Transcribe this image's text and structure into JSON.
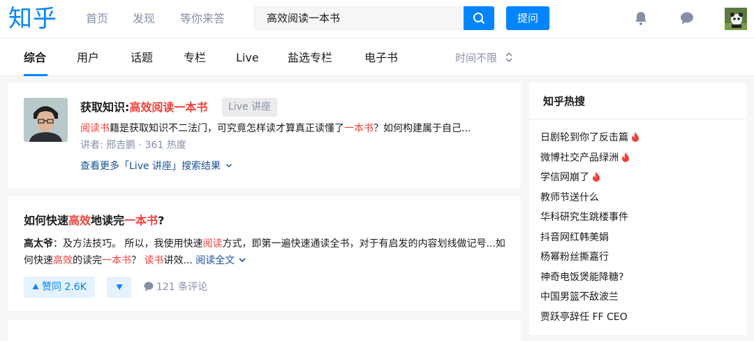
{
  "header": {
    "logo": "知乎",
    "nav": [
      "首页",
      "发现",
      "等你来答"
    ],
    "search_value": "高效阅读一本书",
    "ask_label": "提问",
    "accent": "#0084ff"
  },
  "tabs": {
    "items": [
      "综合",
      "用户",
      "话题",
      "专栏",
      "Live",
      "盐选专栏",
      "电子书"
    ],
    "active": "综合",
    "time_filter": "时间不限"
  },
  "live_card": {
    "title_prefix": "获取知识:",
    "title_highlight": "高效阅读一本书",
    "tag": "Live 讲座",
    "desc_hl1": "阅读书",
    "desc_text1": "籍是获取知识不二法门，可究竟怎样读才算真正读懂了",
    "desc_hl2": "一本书",
    "desc_text2": "？如何构建属于自己...",
    "meta": "讲者: 邢吉鹏 · 361 热度",
    "more_link": "查看更多「Live 讲座」搜索结果"
  },
  "question_card": {
    "title_1": "如何快速",
    "title_hl1": "高效",
    "title_2": "地读完",
    "title_hl2": "一本书",
    "title_3": "?",
    "author": "高太爷",
    "body_1": "：及方法技巧。 所以，我使用快速",
    "body_hl1": "阅读",
    "body_2": "方式，即第一遍快速通读全书，对于有启发的内容划线做记号...如何快速",
    "body_hl2": "高效",
    "body_3": "的读完",
    "body_hl3": "一本书",
    "body_4": "？ ",
    "body_hl4": "读书",
    "body_5": "讲效... ",
    "read_full": "阅读全文",
    "vote_label": "赞同 2.6K",
    "comments": "121 条评论"
  },
  "sidebar": {
    "title": "知乎热搜",
    "items": [
      {
        "text": "日剧轮到你了反击篇",
        "hot": true
      },
      {
        "text": "微博社交产品绿洲",
        "hot": true
      },
      {
        "text": "学信网崩了",
        "hot": true
      },
      {
        "text": "教师节送什么",
        "hot": false
      },
      {
        "text": "华科研究生跳楼事件",
        "hot": false
      },
      {
        "text": "抖音网红韩美娟",
        "hot": false
      },
      {
        "text": "杨幂粉丝撕嘉行",
        "hot": false
      },
      {
        "text": "神奇电饭煲能降糖?",
        "hot": false
      },
      {
        "text": "中国男篮不敌波兰",
        "hot": false
      },
      {
        "text": "贾跃亭辞任 FF CEO",
        "hot": false
      }
    ]
  }
}
